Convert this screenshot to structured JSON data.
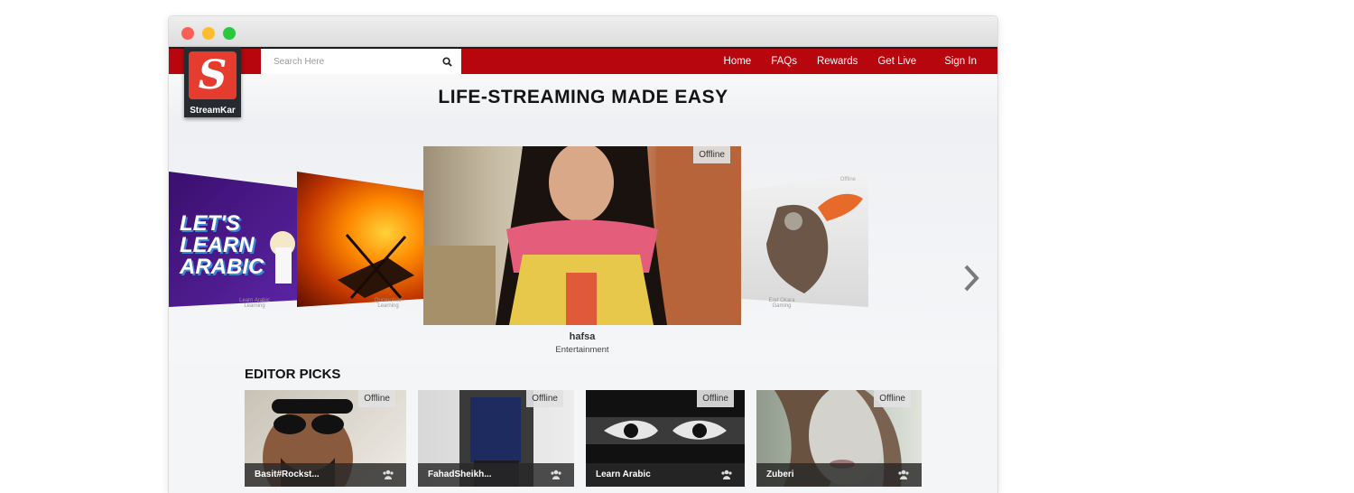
{
  "window": {
    "controls": [
      "close",
      "minimize",
      "maximize"
    ]
  },
  "logo": {
    "text": "StreamKar",
    "glyph": "S"
  },
  "search": {
    "placeholder": "Search Here",
    "value": "",
    "icon": "search-icon"
  },
  "nav": {
    "items": [
      "Home",
      "FAQs",
      "Rewards",
      "Get Live"
    ],
    "sign_in": "Sign In"
  },
  "hero": {
    "title": "LIFE-STREAMING MADE EASY"
  },
  "carousel": {
    "main": {
      "name": "hafsa",
      "category": "Entertainment",
      "status": "Offline"
    },
    "sides": [
      {
        "image_text": "LET'S LEARN ARABIC",
        "name": "Learn Arabic",
        "category": "Learning"
      },
      {
        "name": "Quranofaar",
        "category": "Learning"
      },
      {
        "name": "Eref Okara",
        "category": "Gaming",
        "status": "Offline"
      }
    ],
    "next_icon": "chevron-right-icon"
  },
  "editor_picks": {
    "title": "EDITOR PICKS",
    "items": [
      {
        "name": "Basit#Rockst...",
        "status": "Offline",
        "icon": "users-icon"
      },
      {
        "name": "FahadSheikh...",
        "status": "Offline",
        "icon": "users-icon"
      },
      {
        "name": "Learn Arabic",
        "status": "Offline",
        "icon": "users-icon"
      },
      {
        "name": "Zuberi",
        "status": "Offline",
        "icon": "users-icon"
      }
    ]
  },
  "colors": {
    "nav_red": "#b8060e",
    "logo_red": "#e43c2f",
    "logo_dark": "#272a2e"
  }
}
